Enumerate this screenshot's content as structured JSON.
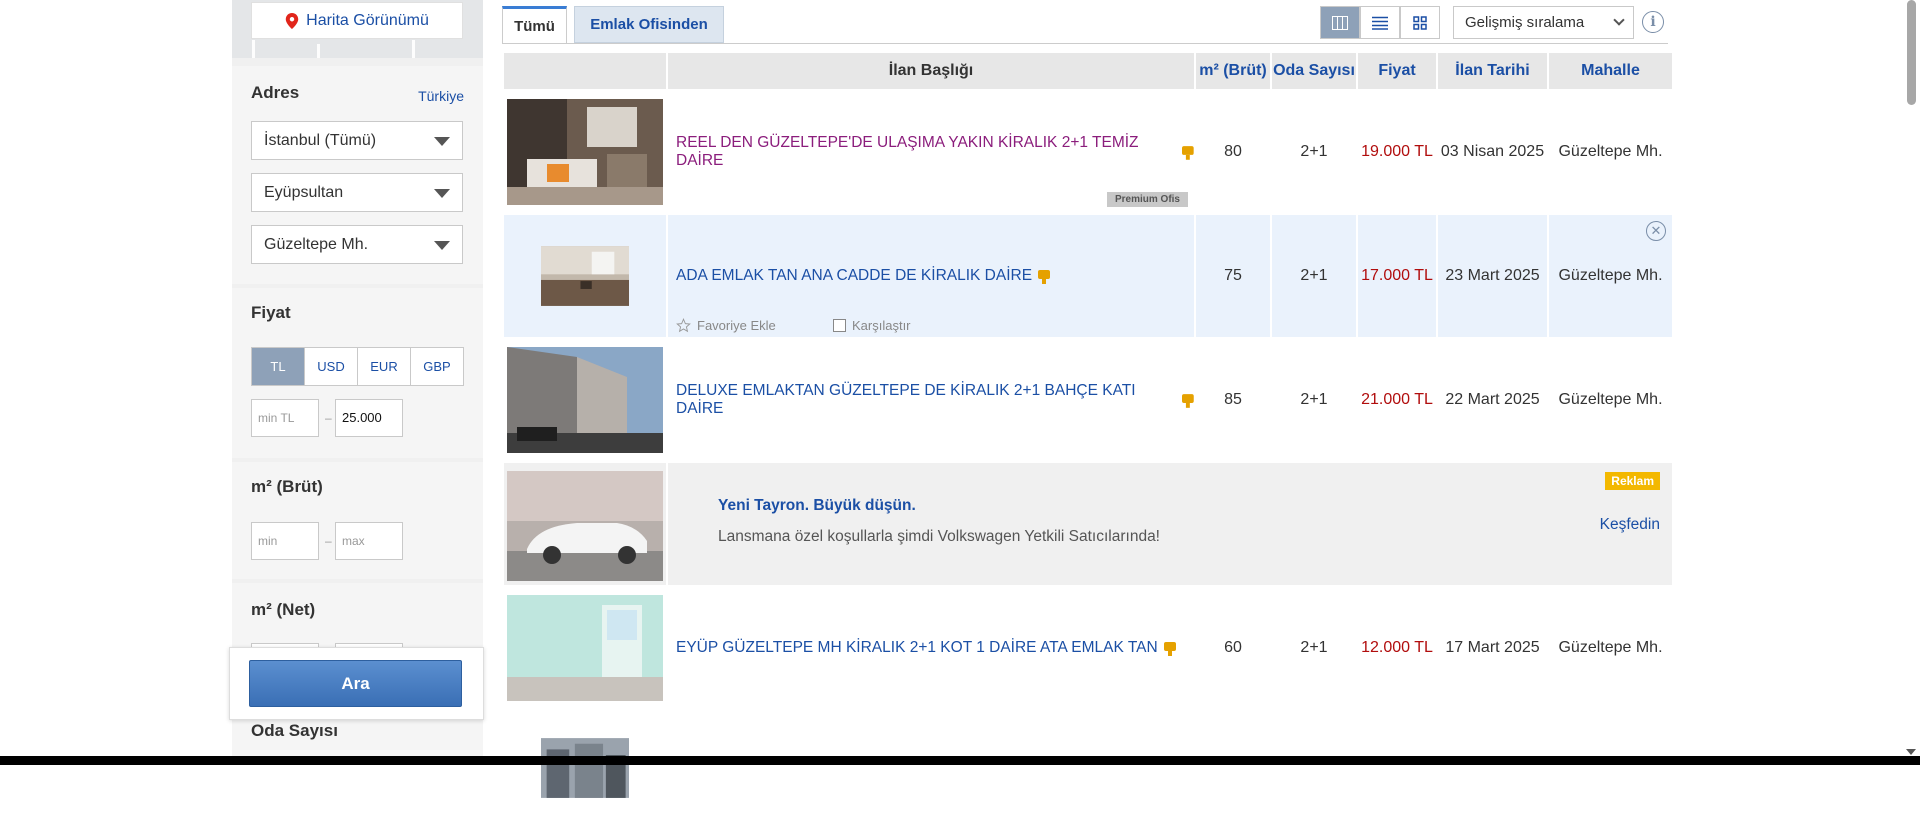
{
  "sidebar": {
    "map_button": "Harita Görünümü",
    "address": {
      "title": "Adres",
      "country_link": "Türkiye",
      "city": "İstanbul (Tümü)",
      "district": "Eyüpsultan",
      "neighborhood": "Güzeltepe Mh."
    },
    "price": {
      "title": "Fiyat",
      "currencies": [
        "TL",
        "USD",
        "EUR",
        "GBP"
      ],
      "active_currency": "TL",
      "min_placeholder": "min TL",
      "max_value": "25.000",
      "dash": "–"
    },
    "m2_gross": {
      "title": "m² (Brüt)",
      "min_placeholder": "min",
      "max_placeholder": "max",
      "dash": "–"
    },
    "m2_net": {
      "title": "m² (Net)"
    },
    "rooms": {
      "title": "Oda Sayısı"
    },
    "search_button": "Ara"
  },
  "tabs": [
    "Tümü",
    "Emlak Ofisinden"
  ],
  "toolbar": {
    "sort_label": "Gelişmiş sıralama",
    "view_modes": [
      "grid-table-icon",
      "list-icon",
      "gallery-icon"
    ],
    "info": "i"
  },
  "table": {
    "headers": [
      "",
      "İlan Başlığı",
      "m² (Brüt)",
      "Oda Sayısı",
      "Fiyat",
      "İlan Tarihi",
      "Mahalle"
    ],
    "rows": [
      {
        "title": "REEL DEN GÜZELTEPE'DE ULAŞIMA YAKIN KİRALIK 2+1 TEMİZ DAİRE",
        "m2": "80",
        "rooms": "2+1",
        "price": "19.000 TL",
        "date": "03 Nisan 2025",
        "neighborhood": "Güzeltepe Mh.",
        "tag": "Premium Ofis"
      },
      {
        "title": "ADA EMLAK TAN ANA CADDE DE KİRALIK DAİRE",
        "m2": "75",
        "rooms": "2+1",
        "price": "17.000 TL",
        "date": "23 Mart 2025",
        "neighborhood": "Güzeltepe Mh.",
        "fav": "Favoriye Ekle",
        "compare": "Karşılaştır"
      },
      {
        "title": "DELUXE EMLAKTAN GÜZELTEPE DE KİRALIK 2+1 BAHÇE KATI DAİRE",
        "m2": "85",
        "rooms": "2+1",
        "price": "21.000 TL",
        "date": "22 Mart 2025",
        "neighborhood": "Güzeltepe Mh."
      },
      {
        "title": "EYÜP GÜZELTEPE MH KİRALIK 2+1 KOT 1 DAİRE ATA EMLAK TAN",
        "m2": "60",
        "rooms": "2+1",
        "price": "12.000 TL",
        "date": "17 Mart 2025",
        "neighborhood": "Güzeltepe Mh."
      }
    ],
    "ad": {
      "title": "Yeni Tayron. Büyük düşün.",
      "description": "Lansmana özel koşullarla şimdi Volkswagen Yetkili Satıcılarında!",
      "badge": "Reklam",
      "link": "Keşfedin"
    }
  },
  "colors": {
    "link": "#1b4fa5",
    "price": "#b10d0d",
    "visited": "#8b1d7c",
    "active_tab_border": "#3a7dd4",
    "ad_badge": "#f3b800"
  }
}
